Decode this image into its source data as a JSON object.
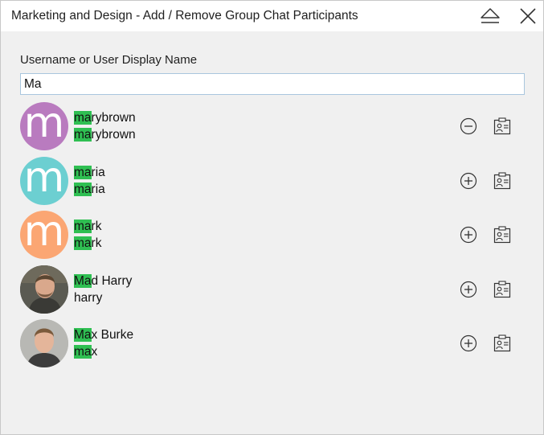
{
  "window": {
    "title": "Marketing and Design - Add / Remove Group Chat Participants",
    "icons": [
      "eject-icon",
      "close-icon"
    ]
  },
  "search": {
    "label": "Username or User Display Name",
    "value": "Ma"
  },
  "colors": {
    "highlight": "#2fbf52",
    "avatar_purple": "#b97bbf",
    "avatar_teal": "#6ccfd1",
    "avatar_orange": "#fba673"
  },
  "users": [
    {
      "display_match": "ma",
      "display_rest": "rybrown",
      "user_match": "ma",
      "user_rest": "rybrown",
      "avatar_type": "letter",
      "avatar_letter": "m",
      "avatar_color": "#b97bbf",
      "action_icon": "minus-circle-icon",
      "contact_icon": "contact-card-icon"
    },
    {
      "display_match": "ma",
      "display_rest": "ria",
      "user_match": "ma",
      "user_rest": "ria",
      "avatar_type": "letter",
      "avatar_letter": "m",
      "avatar_color": "#6ccfd1",
      "action_icon": "plus-circle-icon",
      "contact_icon": "contact-card-icon"
    },
    {
      "display_match": "ma",
      "display_rest": "rk",
      "user_match": "ma",
      "user_rest": "rk",
      "avatar_type": "letter",
      "avatar_letter": "m",
      "avatar_color": "#fba673",
      "action_icon": "plus-circle-icon",
      "contact_icon": "contact-card-icon"
    },
    {
      "display_match": "Ma",
      "display_rest": "d Harry",
      "user_match": "",
      "user_rest": "harry",
      "avatar_type": "photo",
      "avatar_letter": "",
      "avatar_color": "#5a5a52",
      "action_icon": "plus-circle-icon",
      "contact_icon": "contact-card-icon"
    },
    {
      "display_match": "Ma",
      "display_rest": "x Burke",
      "user_match": "ma",
      "user_rest": "x",
      "avatar_type": "photo",
      "avatar_letter": "",
      "avatar_color": "#b8b8b4",
      "action_icon": "plus-circle-icon",
      "contact_icon": "contact-card-icon"
    }
  ]
}
